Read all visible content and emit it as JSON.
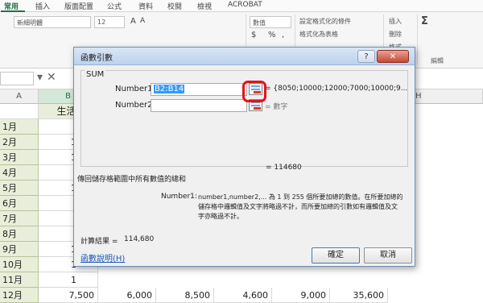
{
  "ribbon": {
    "tabs": [
      "常用",
      "插入",
      "版面配置",
      "公式",
      "資料",
      "校閱",
      "檢視",
      "ACROBAT"
    ],
    "font_name": "新細明體",
    "font_size": "12",
    "number_format": "數值",
    "currency_symbol": "$",
    "percent_symbol": "%",
    "comma_symbol": ",",
    "cond_format": "設定格式化的條件",
    "format_as_table": "格式化為表格",
    "insert": "插入",
    "delete": "刪除",
    "format": "格式",
    "sum_symbol": "Σ",
    "editing_group": "編輯"
  },
  "formula_bar": {
    "cancel_symbol": "✕"
  },
  "grid": {
    "col_a": "A",
    "col_b": "B",
    "col_h": "H",
    "header_text": "生活",
    "rows": [
      {
        "month": "1月",
        "b": ""
      },
      {
        "month": "2月",
        "b": "1"
      },
      {
        "month": "3月",
        "b": "1"
      },
      {
        "month": "4月",
        "b": ""
      },
      {
        "month": "5月",
        "b": "1"
      },
      {
        "month": "6月",
        "b": ""
      },
      {
        "month": "7月",
        "b": ""
      },
      {
        "month": "8月",
        "b": ""
      },
      {
        "month": "9月",
        "b": "1"
      },
      {
        "month": "10月",
        "b": "1"
      },
      {
        "month": "11月",
        "b": "1"
      }
    ],
    "last_row": {
      "month": "12月",
      "values": [
        "7,500",
        "6,000",
        "8,500",
        "4,600",
        "9,000",
        "35,600"
      ]
    }
  },
  "dialog": {
    "title": "函數引數",
    "help_symbol": "?",
    "close_symbol": "✕",
    "function_name": "SUM",
    "arg1_label": "Number1",
    "arg1_value": "B2:B14",
    "arg1_result": "= {8050;10000;12000;7000;10000;9...",
    "arg2_label": "Number2",
    "arg2_value": "",
    "arg2_result": "= 數字",
    "total_preview": "= 114680",
    "description": "傳回儲存格範圍中所有數值的總和",
    "detail_label": "Number1:",
    "detail_text_1": "number1,number2,... 為 1 到 255 個所要加總的數值。在所要加總的",
    "detail_text_2": "儲存格中邏輯值及文字將略過不計，而所要加總的引數如有邏輯值及文",
    "detail_text_3": "字亦略過不計。",
    "result_label": "計算結果 =",
    "result_value": "114,680",
    "help_link": "函數說明(H)",
    "ok_label": "確定",
    "cancel_label": "取消"
  }
}
